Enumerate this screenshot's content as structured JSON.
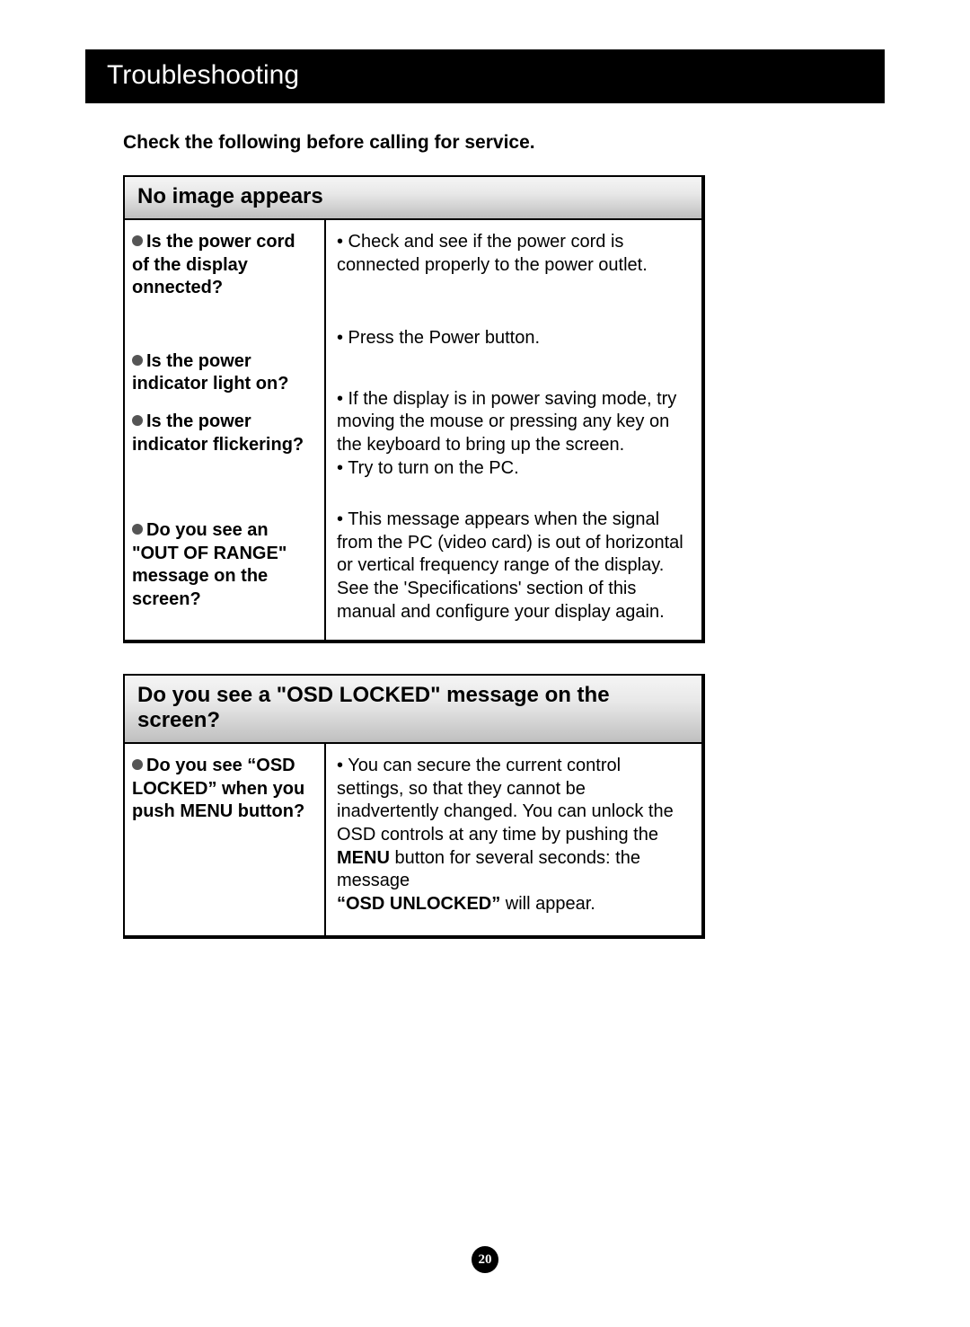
{
  "title": "Troubleshooting",
  "intro": "Check the following before calling for service.",
  "panel1": {
    "header": "No image appears",
    "rows": [
      {
        "q": "Is the power cord of the display onnected?",
        "a": "• Check and see if the power cord is connected properly to the power outlet."
      },
      {
        "q": "Is the power indicator light on?",
        "a": "• Press the Power button."
      },
      {
        "q": "Is the power indicator flickering?",
        "a": "• If the display is in power saving mode, try moving the mouse or pressing any key on the keyboard to bring up the screen.\n• Try to turn on the PC."
      },
      {
        "q": "Do you see an \"OUT OF RANGE\" message on the screen?",
        "a": "• This message appears when the signal from the PC (video card) is out of horizontal or vertical frequency range of the display. See the 'Specifications' section of this manual and configure your display again."
      }
    ]
  },
  "panel2": {
    "header": "Do you see a \"OSD LOCKED\" message on the screen?",
    "q": "Do you see “OSD LOCKED” when you push MENU button?",
    "a_pre": "• You can secure the current control settings, so that they cannot be inadvertently changed. You can unlock the OSD controls at any time by pushing the ",
    "a_bold1": "MENU",
    "a_mid": " button for several seconds: the message ",
    "a_bold2": "“OSD UNLOCKED”",
    "a_post": " will appear."
  },
  "page_number": "20"
}
